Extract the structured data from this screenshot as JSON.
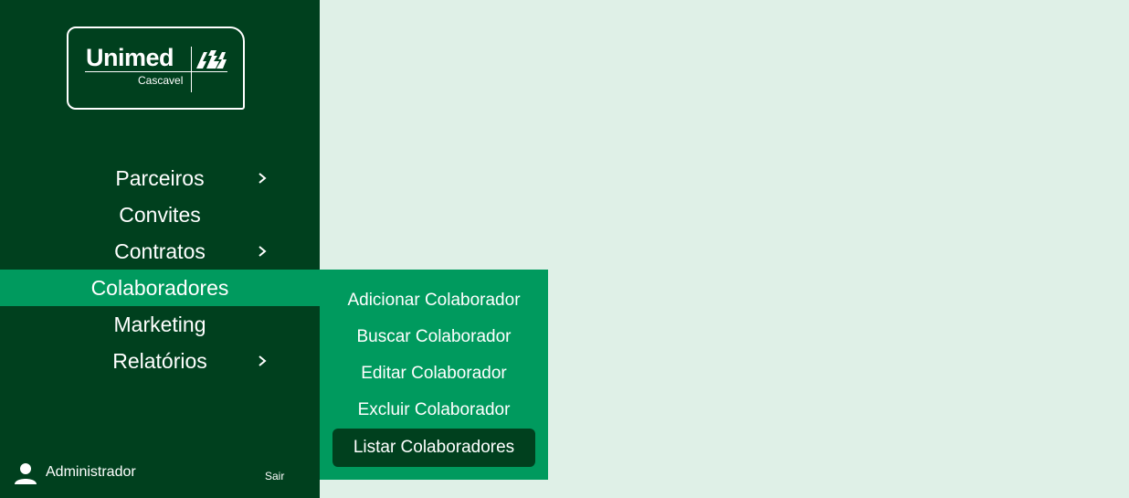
{
  "colors": {
    "sidebar_bg": "#00401e",
    "active_bg": "#009a5e",
    "page_bg": "#dff0e7",
    "text": "#ffffff"
  },
  "logo": {
    "brand": "Unimed",
    "subtitle": "Cascavel",
    "icon": "unimed-trees-icon"
  },
  "menu": {
    "items": [
      {
        "label": "Parceiros",
        "has_submenu": true,
        "icon": "chevron-right-icon"
      },
      {
        "label": "Convites",
        "has_submenu": false
      },
      {
        "label": "Contratos",
        "has_submenu": true,
        "icon": "chevron-right-icon"
      },
      {
        "label": "Colaboradores",
        "has_submenu": false,
        "active": true
      },
      {
        "label": "Marketing",
        "has_submenu": false
      },
      {
        "label": "Relatórios",
        "has_submenu": true,
        "icon": "chevron-right-icon"
      }
    ]
  },
  "submenu": {
    "items": [
      {
        "label": "Adicionar Colaborador"
      },
      {
        "label": "Buscar Colaborador"
      },
      {
        "label": "Editar Colaborador"
      },
      {
        "label": "Excluir Colaborador"
      },
      {
        "label": "Listar Colaboradores",
        "selected": true
      }
    ]
  },
  "footer": {
    "user_icon": "person-icon",
    "user_name": "Administrador",
    "logout_label": "Sair"
  }
}
